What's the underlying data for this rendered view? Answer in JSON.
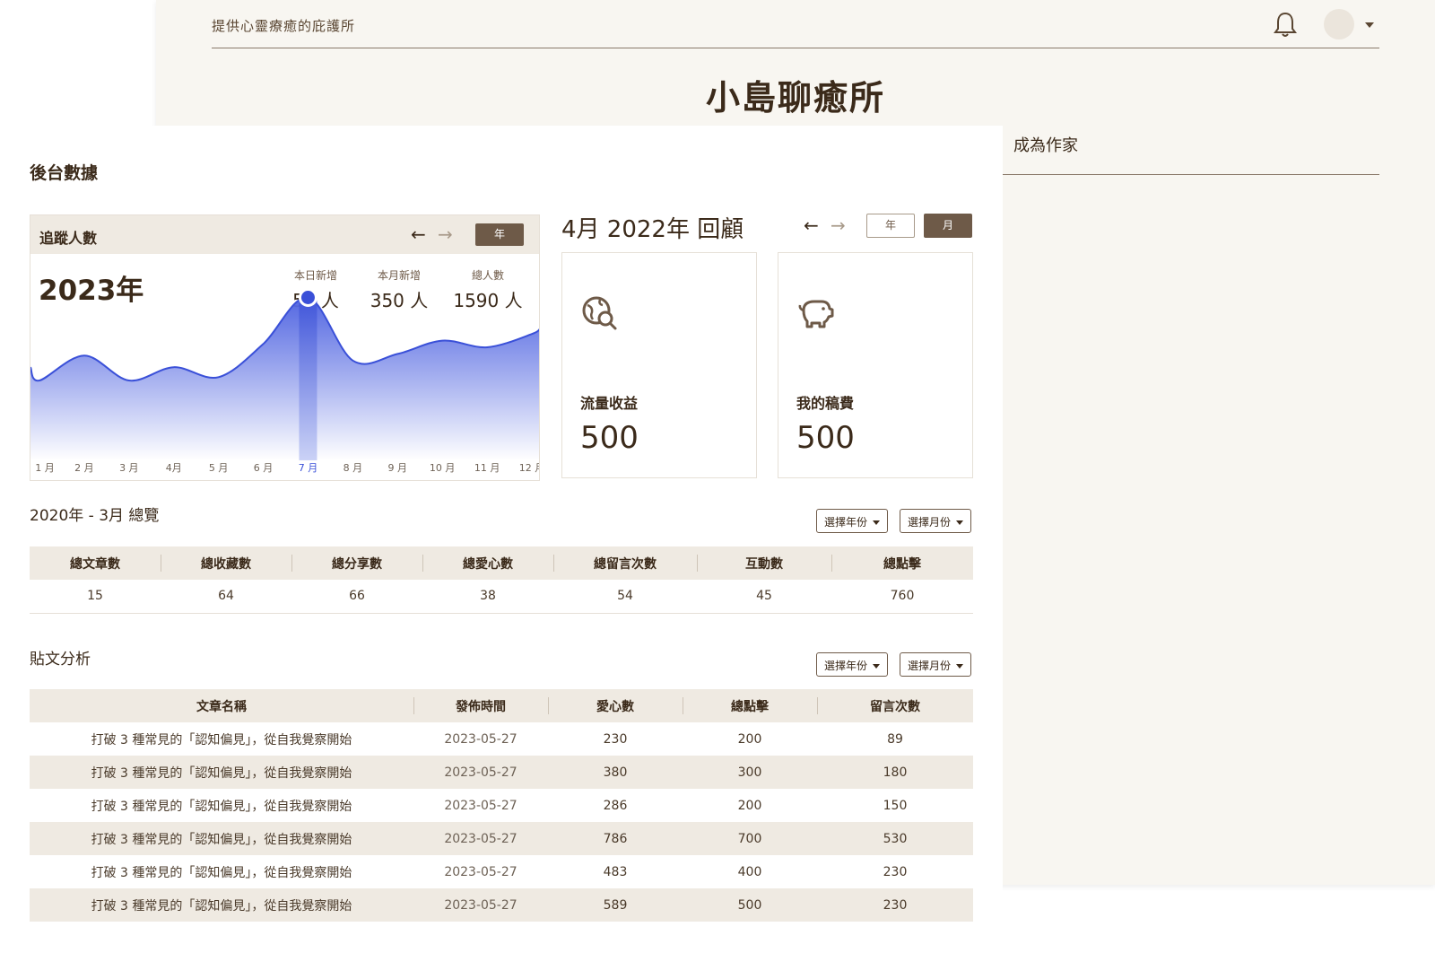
{
  "site": {
    "tagline": "提供心靈療癒的庇護所",
    "logo": "小島聊癒所",
    "become_writer": "成為作家"
  },
  "dashboard": {
    "title": "後台數據",
    "followers": {
      "title": "追蹤人數",
      "period_button": "年",
      "year_label": "2023年",
      "stats": [
        {
          "label": "本日新增",
          "value": "57 人"
        },
        {
          "label": "本月新增",
          "value": "350 人"
        },
        {
          "label": "總人數",
          "value": "1590 人"
        }
      ]
    },
    "review": {
      "title": "4月 2022年 回顧",
      "year_button": "年",
      "month_button": "月",
      "cards": [
        {
          "icon": "globe-search-icon",
          "label": "流量收益",
          "value": "500"
        },
        {
          "icon": "piggy-bank-icon",
          "label": "我的稿費",
          "value": "500"
        }
      ]
    },
    "overview": {
      "title": "2020年 - 3月  總覽",
      "select_year": "選擇年份",
      "select_month": "選擇月份",
      "headers": [
        "總文章數",
        "總收藏數",
        "總分享數",
        "總愛心數",
        "總留言次數",
        "互動數",
        "總點擊"
      ],
      "values": [
        "15",
        "64",
        "66",
        "38",
        "54",
        "45",
        "760"
      ]
    },
    "posts": {
      "title": "貼文分析",
      "select_year": "選擇年份",
      "select_month": "選擇月份",
      "headers": [
        "文章名稱",
        "發佈時間",
        "愛心數",
        "總點擊",
        "留言次數"
      ],
      "rows": [
        [
          "打破 3 種常見的「認知偏見」，從自我覺察開始",
          "2023-05-27",
          "230",
          "200",
          "89"
        ],
        [
          "打破 3 種常見的「認知偏見」，從自我覺察開始",
          "2023-05-27",
          "380",
          "300",
          "180"
        ],
        [
          "打破 3 種常見的「認知偏見」，從自我覺察開始",
          "2023-05-27",
          "286",
          "200",
          "150"
        ],
        [
          "打破 3 種常見的「認知偏見」，從自我覺察開始",
          "2023-05-27",
          "786",
          "700",
          "530"
        ],
        [
          "打破 3 種常見的「認知偏見」，從自我覺察開始",
          "2023-05-27",
          "483",
          "400",
          "230"
        ],
        [
          "打破 3 種常見的「認知偏見」，從自我覺察開始",
          "2023-05-27",
          "589",
          "500",
          "230"
        ]
      ]
    }
  },
  "chart_data": {
    "type": "area",
    "categories": [
      "1 月",
      "2 月",
      "3 月",
      "4月",
      "5 月",
      "6 月",
      "7 月",
      "8 月",
      "9 月",
      "10 月",
      "11 月",
      "12 月"
    ],
    "series": [
      {
        "values": [
          40,
          55,
          40,
          48,
          42,
          62,
          90,
          52,
          56,
          64,
          60,
          68
        ]
      }
    ],
    "highlight_index": 6,
    "ylim": [
      0,
      100
    ],
    "grid": false,
    "colors": {
      "fill_top": "#4a5fe0",
      "fill_bottom": "#ffffff",
      "line": "#3a50d8",
      "highlight": "#3a50d8"
    }
  },
  "colors": {
    "accent_dark": "#6e5a48",
    "header_bg": "#efeae2",
    "page_bg": "#f8f6f1",
    "text": "#3b2a1a"
  }
}
